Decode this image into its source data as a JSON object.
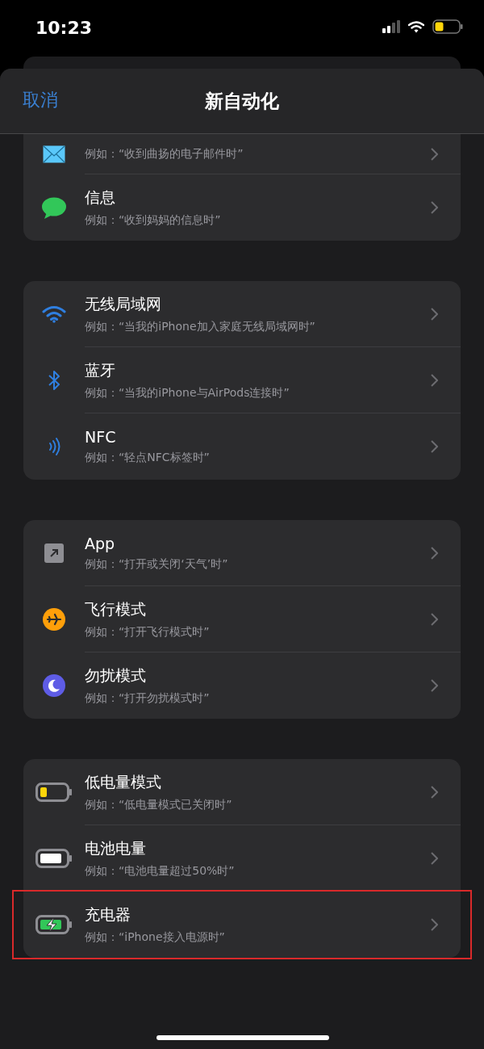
{
  "status_bar": {
    "time": "10:23"
  },
  "header": {
    "cancel": "取消",
    "title": "新自动化"
  },
  "groups": [
    {
      "rows": [
        {
          "kind": "mail",
          "subtitle": "例如：“收到曲扬的电子邮件时”",
          "highlighted": false
        },
        {
          "kind": "message",
          "title": "信息",
          "subtitle": "例如：“收到妈妈的信息时”",
          "highlighted": false
        }
      ]
    },
    {
      "rows": [
        {
          "kind": "wifi",
          "title": "无线局域网",
          "subtitle": "例如：“当我的iPhone加入家庭无线局域网时”",
          "highlighted": false
        },
        {
          "kind": "bluetooth",
          "title": "蓝牙",
          "subtitle": "例如：“当我的iPhone与AirPods连接时”",
          "highlighted": false
        },
        {
          "kind": "nfc",
          "title": "NFC",
          "subtitle": "例如：“轻点NFC标签时”",
          "highlighted": false
        }
      ]
    },
    {
      "rows": [
        {
          "kind": "app",
          "title": "App",
          "subtitle": "例如：“打开或关闭‘天气’时”",
          "highlighted": false
        },
        {
          "kind": "airplane",
          "title": "飞行模式",
          "subtitle": "例如：“打开飞行模式时”",
          "highlighted": false
        },
        {
          "kind": "moon",
          "title": "勿扰模式",
          "subtitle": "例如：“打开勿扰模式时”",
          "highlighted": false
        }
      ]
    },
    {
      "rows": [
        {
          "kind": "battery-low",
          "title": "低电量模式",
          "subtitle": "例如：“低电量模式已关闭时”",
          "highlighted": false
        },
        {
          "kind": "battery",
          "title": "电池电量",
          "subtitle": "例如：“电池电量超过50%时”",
          "highlighted": false
        },
        {
          "kind": "battery-charging",
          "title": "充电器",
          "subtitle": "例如：“iPhone接入电源时”",
          "highlighted": true
        }
      ]
    }
  ]
}
